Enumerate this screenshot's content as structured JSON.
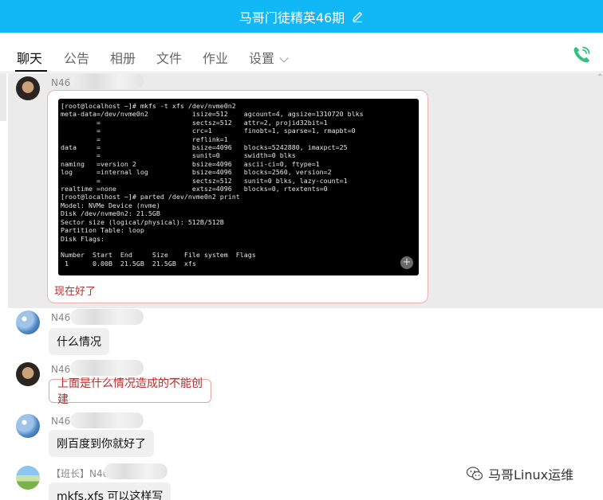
{
  "title": "马哥门徒精英46期",
  "tabs": [
    {
      "label": "聊天",
      "active": true
    },
    {
      "label": "公告"
    },
    {
      "label": "相册"
    },
    {
      "label": "文件"
    },
    {
      "label": "作业"
    },
    {
      "label": "设置"
    }
  ],
  "messages": [
    {
      "sender": "N46",
      "avatar": "dark-portrait",
      "terminal_lines": [
        "[root@localhost ~]# mkfs -t xfs /dev/nvme0n2",
        "meta-data=/dev/nvme0n2           isize=512    agcount=4, agsize=1310720 blks",
        "         =                       sectsz=512   attr=2, projid32bit=1",
        "         =                       crc=1        finobt=1, sparse=1, rmapbt=0",
        "         =                       reflink=1",
        "data     =                       bsize=4096   blocks=5242880, imaxpct=25",
        "         =                       sunit=0      swidth=0 blks",
        "naming   =version 2              bsize=4096   ascii-ci=0, ftype=1",
        "log      =internal log           bsize=4096   blocks=2560, version=2",
        "         =                       sectsz=512   sunit=0 blks, lazy-count=1",
        "realtime =none                   extsz=4096   blocks=0, rtextents=0",
        "[root@localhost ~]# parted /dev/nvme0n2 print",
        "Model: NVMe Device (nvme)",
        "Disk /dev/nvme0n2: 21.5GB",
        "Sector size (logical/physical): 512B/512B",
        "Partition Table: loop",
        "Disk Flags:",
        "",
        "Number  Start  End     Size    File system  Flags",
        " 1      0.00B  21.5GB  21.5GB  xfs"
      ],
      "caption": "现在好了"
    },
    {
      "sender": "N46",
      "avatar": "blue-globe",
      "text": "什么情况"
    },
    {
      "sender": "N46",
      "avatar": "dark-portrait",
      "text": "上面是什么情况造成的不能创建"
    },
    {
      "sender": "N46",
      "avatar": "blue-globe",
      "text": "刚百度到你就好了"
    },
    {
      "sender": "【班长】N46",
      "avatar": "green-landscape",
      "text": "mkfs.xfs 可以这样写"
    }
  ],
  "watermark": "马哥Linux运维",
  "icons": {
    "edit": "pencil-icon",
    "phone": "phone-icon",
    "zoom": "plus-icon",
    "watermark": "wechat-icon"
  },
  "colors": {
    "title_bar": "#12b7f5",
    "highlight_text": "#b03030",
    "phone": "#2ec27e"
  }
}
